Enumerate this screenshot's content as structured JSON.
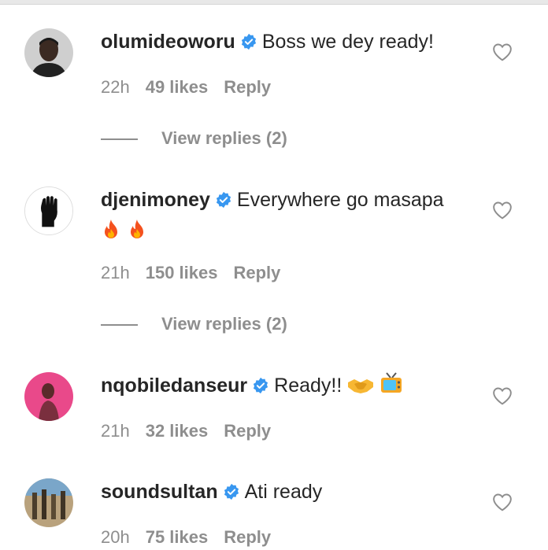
{
  "comments": [
    {
      "username": "olumideoworu",
      "text": "Boss we dey ready!",
      "time": "22h",
      "likes": "49 likes",
      "reply": "Reply",
      "view_replies": "View replies (2)"
    },
    {
      "username": "djenimoney",
      "text": "Everywhere go masapa",
      "time": "21h",
      "likes": "150 likes",
      "reply": "Reply",
      "view_replies": "View replies (2)"
    },
    {
      "username": "nqobiledanseur",
      "text": "Ready!!",
      "time": "21h",
      "likes": "32 likes",
      "reply": "Reply"
    },
    {
      "username": "soundsultan",
      "text": "Ati ready",
      "time": "20h",
      "likes": "75 likes",
      "reply": "Reply"
    }
  ],
  "icons": {
    "verified": "verified-badge-icon",
    "like": "heart-outline-icon",
    "fire": "fire-emoji",
    "handshake": "handshake-emoji",
    "tv": "television-emoji"
  },
  "colors": {
    "verified": "#3897f0",
    "muted": "#8e8e8e",
    "text": "#262626"
  }
}
